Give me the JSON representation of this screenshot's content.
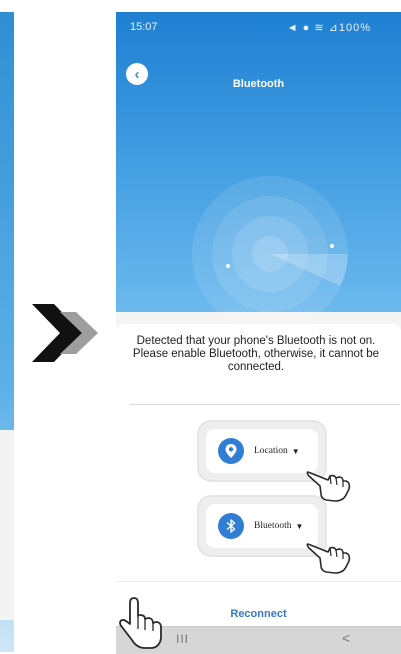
{
  "status_bar": {
    "time": "15:07",
    "right_indicators": "◄ ● ≋ ⊿100%"
  },
  "header": {
    "title": "Bluetooth"
  },
  "dialog": {
    "message_line1": "Detected that your phone's Bluetooth is not on.",
    "message_line2": "Please enable Bluetooth, otherwise, it cannot be",
    "message_line3": "connected.",
    "permissions": [
      {
        "label": "Location",
        "icon": "location-pin-icon"
      },
      {
        "label": "Bluetooth",
        "icon": "bluetooth-icon"
      }
    ],
    "reconnect_label": "Reconnect"
  },
  "nav": {
    "recents": "III",
    "back": "<"
  },
  "colors": {
    "brand_blue": "#2f7ed3",
    "header_gradient_top": "#1f7fd2",
    "link_blue": "#3978c8"
  }
}
